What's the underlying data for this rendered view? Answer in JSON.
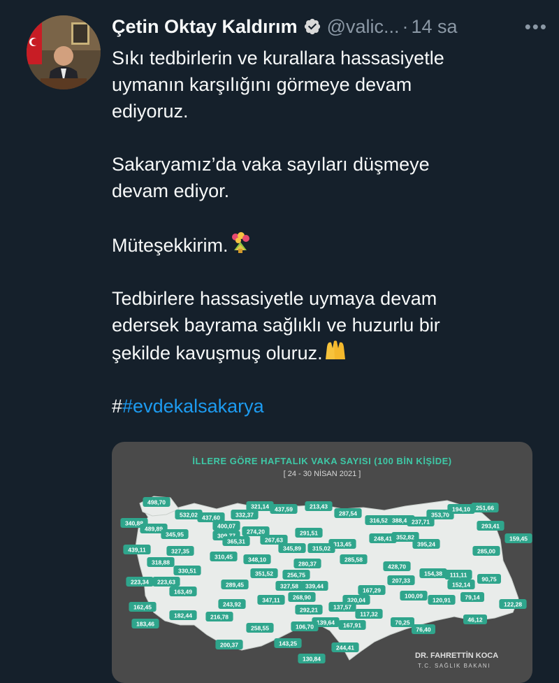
{
  "author": {
    "name": "Çetin Oktay Kaldırım",
    "handle": "@valic...",
    "separator": "·",
    "time": "14 sa",
    "more": "•••"
  },
  "tweet": {
    "line1": "Sıkı tedbirlerin ve kurallara hassasiyetle",
    "line2": "uymanın karşılığını görmeye devam",
    "line3": "ediyoruz.",
    "line4": "Sakaryamız’da vaka sayıları düşmeye",
    "line5": "devam ediyor.",
    "line6": "Müteşekkirim.",
    "line7": "Tedbirlere hassasiyetle uymaya devam",
    "line8": "edersek bayrama sağlıklı ve huzurlu bir",
    "line9": "şekilde kavuşmuş oluruz.",
    "hash_prefix": "#",
    "hashtag": "#evdekalsakarya"
  },
  "media": {
    "title": "İLLERE GÖRE HAFTALIK VAKA SAYISI (100 BİN KİŞİDE)",
    "subtitle": "[ 24 - 30 NİSAN 2021 ]",
    "signature_name": "DR. FAHRETTİN KOCA",
    "signature_title": "T.C. SAĞLIK BAKANI",
    "values": [
      "498,70",
      "532,02",
      "340,88",
      "489,89",
      "437,60",
      "400,07",
      "332,37",
      "321,14",
      "437,59",
      "213,43",
      "287,54",
      "316,52",
      "388,44",
      "237,71",
      "353,70",
      "194,10",
      "251,66",
      "293,41",
      "159,45",
      "345,95",
      "309,77",
      "274,20",
      "365,31",
      "267,63",
      "291,51",
      "313,45",
      "248,41",
      "352,82",
      "285,00",
      "439,11",
      "327,35",
      "310,45",
      "348,10",
      "345,89",
      "315,02",
      "285,58",
      "395,24",
      "318,88",
      "330,51",
      "351,52",
      "280,37",
      "256,75",
      "428,70",
      "207,33",
      "154,38",
      "111,11",
      "223,34",
      "223,63",
      "289,45",
      "327,58",
      "339,44",
      "167,29",
      "152,14",
      "90,75",
      "163,49",
      "243,92",
      "347,11",
      "268,90",
      "292,21",
      "320,04",
      "100,09",
      "120,91",
      "79,14",
      "162,45",
      "182,44",
      "216,78",
      "137,57",
      "117,32",
      "70,25",
      "122,28",
      "183,46",
      "258,55",
      "139,64",
      "106,70",
      "167,91",
      "76,40",
      "46,12",
      "200,37",
      "143,25",
      "244,41",
      "130,84"
    ]
  },
  "colors": {
    "background": "#15202b",
    "text": "#f7f9f9",
    "secondary": "#8b98a5",
    "link": "#1d9bf0",
    "verified": "#d9d9d9",
    "map_fill": "#e9ecea",
    "badge": "#2fa58c"
  }
}
